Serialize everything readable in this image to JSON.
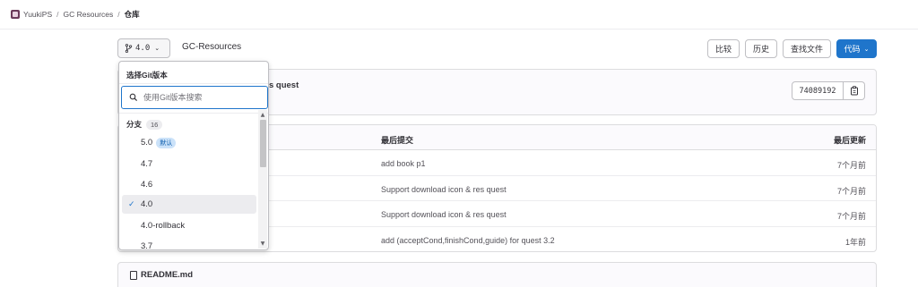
{
  "breadcrumb": {
    "items": [
      "YuukiPS",
      "GC Resources",
      "仓库"
    ],
    "separator": "/"
  },
  "repo_header": {
    "ref_label": "4.0",
    "project_path": "GC-Resources",
    "buttons": {
      "compare": "比较",
      "history": "历史",
      "find_file": "查找文件",
      "code": "代码"
    }
  },
  "last_commit": {
    "title_fragment": "s quest",
    "sha": "74089192"
  },
  "file_table": {
    "headers": {
      "last_commit": "最后提交",
      "last_update": "最后更新"
    },
    "rows": [
      {
        "commit": "add book p1",
        "updated": "7个月前"
      },
      {
        "commit": "Support download icon & res quest",
        "updated": "7个月前"
      },
      {
        "commit": "Support download icon & res quest",
        "updated": "7个月前"
      },
      {
        "commit": "add (acceptCond,finishCond,guide) for quest 3.2",
        "updated": "1年前"
      }
    ]
  },
  "readme": {
    "filename": "README.md"
  },
  "ref_dropdown": {
    "header": "选择Git版本",
    "search_placeholder": "使用Git版本搜索",
    "group_label": "分支",
    "group_count": "16",
    "default_badge": "默认",
    "selected_value": "4.0",
    "items": [
      "5.0",
      "4.7",
      "4.6",
      "4.0",
      "4.0-rollback",
      "3.7"
    ]
  },
  "colors": {
    "accent": "#1f75cb",
    "border": "#dcdcde",
    "panel_bg": "#fbfafd"
  },
  "icons": [
    "project-avatar-icon",
    "branch-icon",
    "chevron-down-icon",
    "copy-icon",
    "file-icon",
    "search-icon",
    "check-icon"
  ]
}
